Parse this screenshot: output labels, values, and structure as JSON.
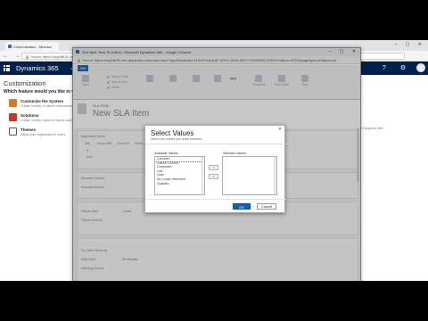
{
  "browser": {
    "tab_title": "Customization - Microso",
    "url": "https://org18831.crm.dynamics.com/",
    "secure_label": "Secure",
    "win_controls": "– ▢ ✕"
  },
  "dynamics": {
    "app_name": "Dynamics 365",
    "area_caret": "⌄ S",
    "right_icons": "? ⚙"
  },
  "customization": {
    "heading": "Customization",
    "question": "Which feature would you like to work with?",
    "options": [
      {
        "title": "Customize the System",
        "desc": "Create, modify, or delete components in your organization",
        "color": "#d9782b"
      },
      {
        "title": "Solutions",
        "desc": "Create, modify, export or import solutions",
        "color": "#c0392b"
      },
      {
        "title": "Themes",
        "desc": "Adjust your organization's colors",
        "color": "#5a5a5a"
      }
    ],
    "right_snippet": "Microsoft Dynamics 365"
  },
  "popup": {
    "title": "SLA Item: New SLA Item - Microsoft Dynamics 365 - Google Chrome",
    "secure_label": "Secure",
    "url": "https://org18831.crm.dynamics.com/main.aspx?appSolutionId=%7bFD140AAF-4DF4-11DD-BD17-0019B9312238%7d&etc=9751&pagetype=entityrecord",
    "file_tab": "File",
    "ribbon_buttons": [
      "Save",
      "",
      "",
      "",
      "",
      "Properties",
      "Form Editor",
      "Help"
    ],
    "ribbon_small": [
      "Save & Close",
      "Save & New",
      "Delete"
    ],
    "form_entity": "SLA ITEM",
    "form_name": "New SLA Item",
    "sections": {
      "applicable": "Applicable When",
      "mini_toolbar": [
        "Add",
        "Group AND",
        "Group OR",
        "Delete"
      ],
      "row_if": "If",
      "row_and": "And",
      "success": "Success Criteria",
      "success_actions": "Success Actions",
      "fail_after_label": "Failure After",
      "fail_after_value": "1 hour",
      "failure_actions": "Failure Actions",
      "warn_heading": "SLA Item Warning",
      "warn_after_label": "Warn After",
      "warn_after_value": "30 minutes",
      "warning_actions": "Warning Actions"
    }
  },
  "dialog": {
    "title": "Select Values",
    "subtitle": "Select the values you want included.",
    "close": "✕",
    "available_label": "Available Values:",
    "selected_label": "Selected Values:",
    "available": [
      "Canceled",
      "Cannot Connect",
      "Completed",
      "Lost",
      "Open",
      "No Longer Interested",
      "Qualified"
    ],
    "move_add": ">",
    "move_remove": "<",
    "ok": "OK",
    "cancel": "Cancel"
  }
}
